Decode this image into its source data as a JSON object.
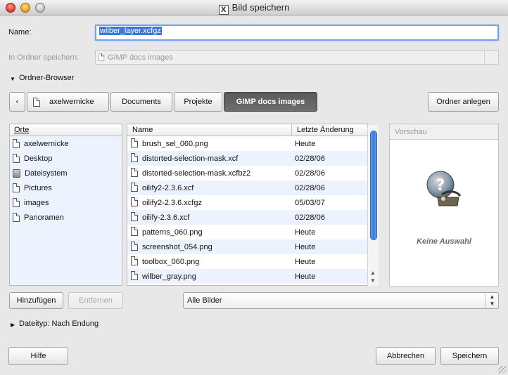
{
  "window": {
    "title": "Bild speichern"
  },
  "name_label": "Name:",
  "name_value": "wilber_layer.xcfgz",
  "save_in_label": "In Ordner speichern:",
  "save_in_value": "GIMP docs images",
  "browser_toggle": "Ordner-Browser",
  "path_bar": {
    "back": "‹",
    "segments": [
      "axelwernicke",
      "Documents",
      "Projekte",
      "GIMP docs images"
    ],
    "active_index": 3
  },
  "create_folder_button": "Ordner anlegen",
  "places": {
    "header": "Orte",
    "items": [
      {
        "label": "axelwernicke",
        "icon": "document-icon"
      },
      {
        "label": "Desktop",
        "icon": "document-icon"
      },
      {
        "label": "Dateisystem",
        "icon": "drive-icon"
      },
      {
        "label": "Pictures",
        "icon": "document-icon"
      },
      {
        "label": "images",
        "icon": "document-icon"
      },
      {
        "label": "Panoramen",
        "icon": "document-icon"
      }
    ]
  },
  "files": {
    "col_name": "Name",
    "col_modified": "Letzte Änderung",
    "rows": [
      {
        "name": "brush_sel_060.png",
        "modified": "Heute"
      },
      {
        "name": "distorted-selection-mask.xcf",
        "modified": "02/28/06"
      },
      {
        "name": "distorted-selection-mask.xcfbz2",
        "modified": "02/28/06"
      },
      {
        "name": "oilify2-2.3.6.xcf",
        "modified": "02/28/06"
      },
      {
        "name": "oilify2-2.3.6.xcfgz",
        "modified": "05/03/07"
      },
      {
        "name": "oilify-2.3.6.xcf",
        "modified": "02/28/06"
      },
      {
        "name": "patterns_060.png",
        "modified": "Heute"
      },
      {
        "name": "screenshot_054.png",
        "modified": "Heute"
      },
      {
        "name": "toolbox_060.png",
        "modified": "Heute"
      },
      {
        "name": "wilber_gray.png",
        "modified": "Heute"
      }
    ]
  },
  "preview": {
    "header": "Vorschau",
    "empty_text": "Keine Auswahl"
  },
  "add_button": "Hinzufügen",
  "remove_button": "Entfernen",
  "filter_value": "Alle Bilder",
  "filetype_toggle": "Dateityp: Nach Endung",
  "help_button": "Hilfe",
  "cancel_button": "Abbrechen",
  "save_button": "Speichern",
  "colors": {
    "accent": "#3b78d8",
    "selection_text": "#ffffff",
    "row_alt": "#edf3fe"
  }
}
